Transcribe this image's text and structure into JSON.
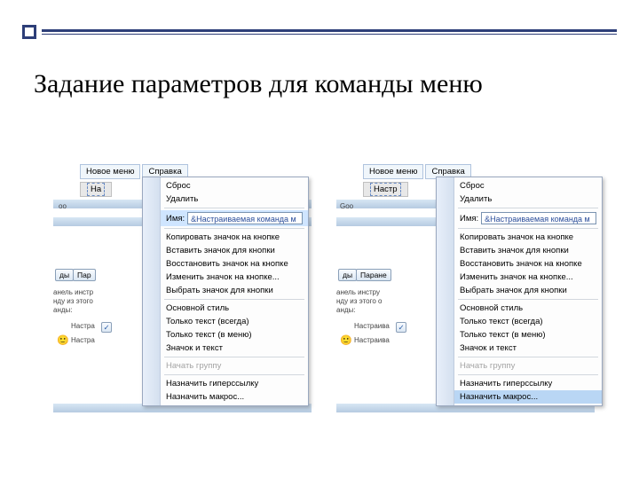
{
  "slide_title": "Задание параметров для команды меню",
  "left": {
    "menubar": [
      "Новое меню",
      "Справка"
    ],
    "toolbar": "На",
    "zoom_hint": "oo",
    "side": {
      "tab1": "ды",
      "tab2": "Пар",
      "text1": "анель инстр",
      "text2": "нду из этого",
      "text3": "анды:",
      "line1": "Настра",
      "line2": "Настра"
    },
    "context": {
      "items_top": [
        "Сброс",
        "Удалить"
      ],
      "name_label": "Имя:",
      "name_value": "&Настраиваемая команда м",
      "items_mid": [
        "Копировать значок на кнопке",
        "Вставить значок для кнопки",
        "Восстановить значок на кнопке",
        "Изменить значок на кнопке...",
        "Выбрать значок для кнопки"
      ],
      "style_header": "Основной стиль",
      "style_items": [
        "Только текст (всегда)",
        "Только текст (в меню)",
        "Значок и текст"
      ],
      "items_bot": [
        {
          "label": "Начать группу",
          "disabled": true
        },
        {
          "label": "Назначить гиперссылку"
        },
        {
          "label": "Назначить макрос..."
        }
      ]
    }
  },
  "right": {
    "menubar": [
      "Новое меню",
      "Справка"
    ],
    "toolbar": "Настр",
    "zoom_hint": "Goo",
    "side": {
      "tab1": "ды",
      "tab2": "Паране",
      "text1": "анель инстру",
      "text2": "нду из этого о",
      "text3": "анды:",
      "line1": "Настраива",
      "line2": "Настраива"
    },
    "context": {
      "items_top": [
        "Сброс",
        "Удалить"
      ],
      "name_label": "Имя:",
      "name_value": "&Настраиваемая команда м",
      "items_mid": [
        "Копировать значок на кнопке",
        "Вставить значок для кнопки",
        "Восстановить значок на кнопке",
        "Изменить значок на кнопке...",
        "Выбрать значок для кнопки"
      ],
      "style_header": "Основной стиль",
      "style_items": [
        "Только текст (всегда)",
        "Только текст (в меню)",
        "Значок и текст"
      ],
      "items_bot": [
        {
          "label": "Начать группу",
          "disabled": true
        },
        {
          "label": "Назначить гиперссылку"
        },
        {
          "label": "Назначить макрос...",
          "highlight": true
        }
      ]
    }
  }
}
